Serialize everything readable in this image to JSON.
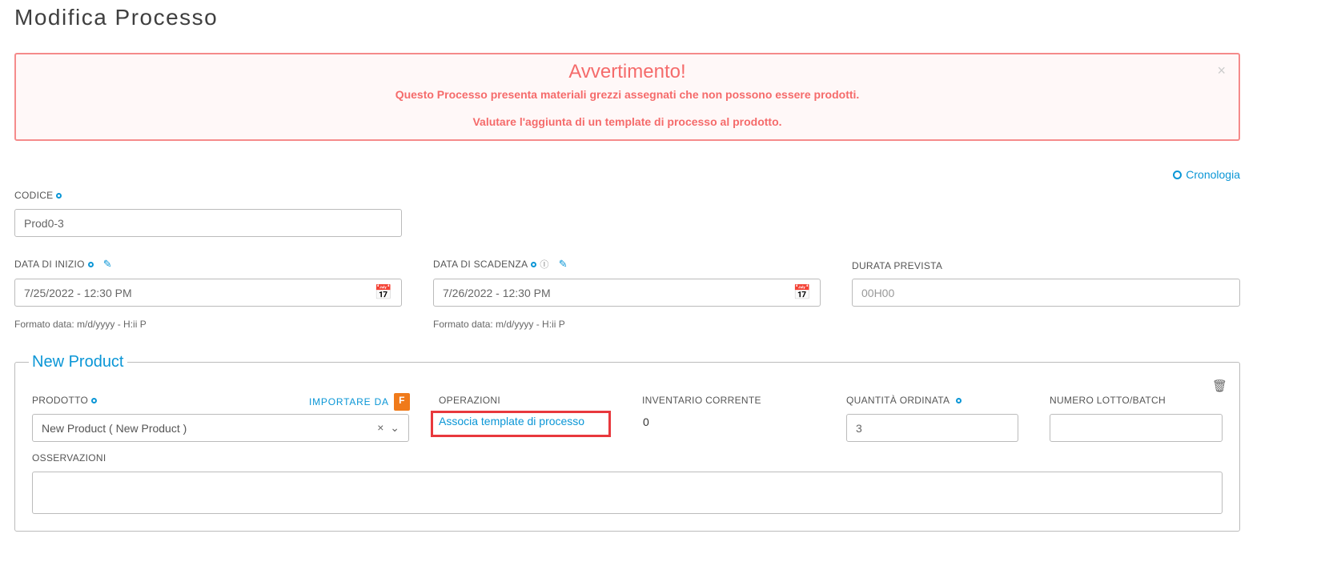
{
  "page": {
    "title": "Modifica Processo"
  },
  "alert": {
    "title": "Avvertimento!",
    "line1": "Questo Processo presenta materiali grezzi assegnati che non possono essere prodotti.",
    "line2": "Valutare l'aggiunta di un template di processo al prodotto.",
    "close": "×"
  },
  "history": {
    "label": "Cronologia"
  },
  "form": {
    "code": {
      "label": "CODICE",
      "value": "Prod0-3"
    },
    "start": {
      "label": "DATA DI INIZIO",
      "value": "7/25/2022 - 12:30 PM",
      "help": "Formato data: m/d/yyyy - H:ii P"
    },
    "due": {
      "label": "DATA DI SCADENZA",
      "value": "7/26/2022 - 12:30 PM",
      "help": "Formato data: m/d/yyyy - H:ii P"
    },
    "duration": {
      "label": "DURATA PREVISTA",
      "placeholder": "00H00"
    }
  },
  "product": {
    "legend": "New Product",
    "product_label": "PRODOTTO",
    "import_label": "IMPORTARE DA",
    "import_icon_letter": "F",
    "product_value": "New Product ( New Product )",
    "operations_label": "OPERAZIONI",
    "operations_link": "Associa template di processo",
    "inventory_label": "INVENTARIO CORRENTE",
    "inventory_value": "0",
    "quantity_label": "QUANTITÀ ORDINATA",
    "quantity_value": "3",
    "lot_label": "NUMERO LOTTO/BATCH",
    "lot_value": "",
    "notes_label": "OSSERVAZIONI",
    "notes_value": ""
  },
  "colors": {
    "accent": "#0a96d6",
    "alert": "#f56b6b",
    "highlight": "#e8383d"
  }
}
